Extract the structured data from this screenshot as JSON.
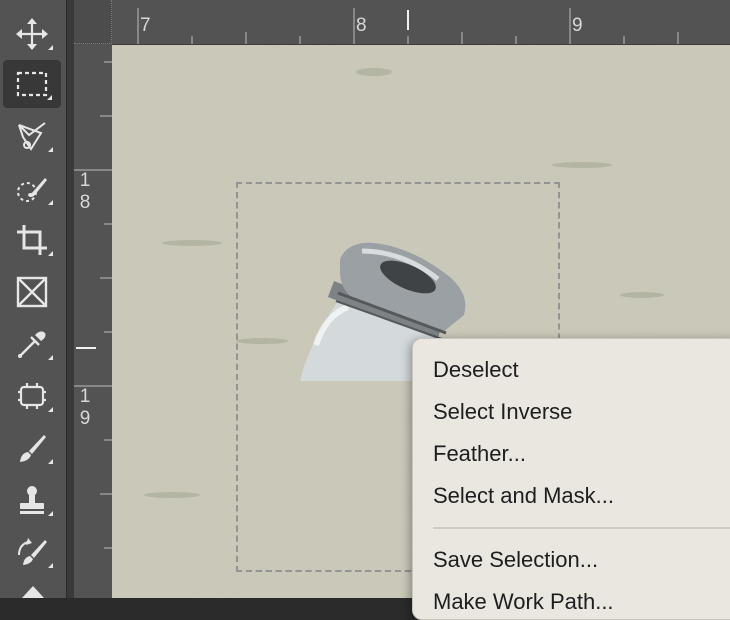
{
  "toolbar": {
    "tools": [
      {
        "icon": "move-icon",
        "active": false
      },
      {
        "icon": "rectangular-marquee-icon",
        "active": true
      },
      {
        "icon": "lasso-icon",
        "active": false
      },
      {
        "icon": "quick-selection-icon",
        "active": false
      },
      {
        "icon": "crop-icon",
        "active": false
      },
      {
        "icon": "frame-icon",
        "active": false
      },
      {
        "icon": "eyedropper-icon",
        "active": false
      },
      {
        "icon": "healing-brush-icon",
        "active": false
      },
      {
        "icon": "brush-icon",
        "active": false
      },
      {
        "icon": "clone-stamp-icon",
        "active": false
      },
      {
        "icon": "history-brush-icon",
        "active": false
      }
    ]
  },
  "rulers": {
    "top_labels": [
      "7",
      "8",
      "9"
    ],
    "left_labels": [
      [
        "1",
        "8"
      ],
      [
        "1",
        "9"
      ]
    ]
  },
  "context_menu": {
    "items": [
      "Deselect",
      "Select Inverse",
      "Feather...",
      "Select and Mask..."
    ],
    "items_after_separator": [
      "Save Selection...",
      "Make Work Path..."
    ]
  },
  "colors": {
    "toolbar_bg": "#535353",
    "canvas_bg": "#cac8b8",
    "menu_bg": "#e9e7e0"
  }
}
